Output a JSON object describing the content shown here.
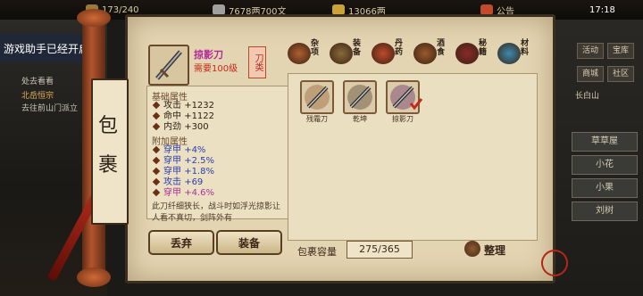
{
  "topbar": {
    "stamina": "173/240",
    "silver": "7678两700文",
    "gold": "13066两",
    "notice_label": "公告",
    "time": "17:18"
  },
  "left_overlay": {
    "assistant_text": "游戏助手已经开启",
    "line1": "处去看看",
    "line2": "北岳恒宗",
    "line3": "去往前山门派立"
  },
  "bag_title": "包裹",
  "item": {
    "name": "掠影刀",
    "requirement": "需要100级",
    "type_tag": "刀类",
    "base_heading": "基础属性",
    "base_stats": [
      {
        "name": "攻击",
        "value": "+1232",
        "color": "#2a1d14"
      },
      {
        "name": "命中",
        "value": "+1122",
        "color": "#2a1d14"
      },
      {
        "name": "内劲",
        "value": "+300",
        "color": "#2a1d14"
      }
    ],
    "extra_heading": "附加属性",
    "extra_stats": [
      {
        "name": "穿甲",
        "value": "+4%",
        "color": "#2b3db0"
      },
      {
        "name": "穿甲",
        "value": "+2.5%",
        "color": "#2b3db0"
      },
      {
        "name": "穿甲",
        "value": "+1.8%",
        "color": "#2b3db0"
      },
      {
        "name": "攻击",
        "value": "+69",
        "color": "#2b3db0"
      },
      {
        "name": "穿甲",
        "value": "+4.6%",
        "color": "#a8329a"
      }
    ],
    "description": "此刀纤细狭长，战斗时如浮光掠影让人看不真切，剑阵外有"
  },
  "buttons": {
    "discard": "丢弃",
    "equip": "装备",
    "sort": "整理"
  },
  "categories": [
    {
      "label": "杂项",
      "icon": "pouch-icon",
      "color": "#b06030"
    },
    {
      "label": "装备",
      "icon": "weapon-icon",
      "color": "#8a6a3a"
    },
    {
      "label": "丹药",
      "icon": "pill-icon",
      "color": "#c04a2a"
    },
    {
      "label": "酒食",
      "icon": "wine-jar-icon",
      "color": "#9a5a2a"
    },
    {
      "label": "秘籍",
      "icon": "book-icon",
      "color": "#8a2a2a"
    },
    {
      "label": "材料",
      "icon": "crystal-icon",
      "color": "#3a8ab0"
    }
  ],
  "inventory": [
    {
      "name": "残霜刀"
    },
    {
      "name": "乾坤"
    },
    {
      "name": "掠影刀"
    }
  ],
  "capacity_label": "包裹容量",
  "capacity_value": "275/365",
  "right_panel": {
    "buttons": [
      "活动",
      "宝库",
      "商城",
      "社区"
    ],
    "location": "长白山",
    "npcs": [
      "草草屋",
      "小花",
      "小果",
      "刘树"
    ]
  }
}
